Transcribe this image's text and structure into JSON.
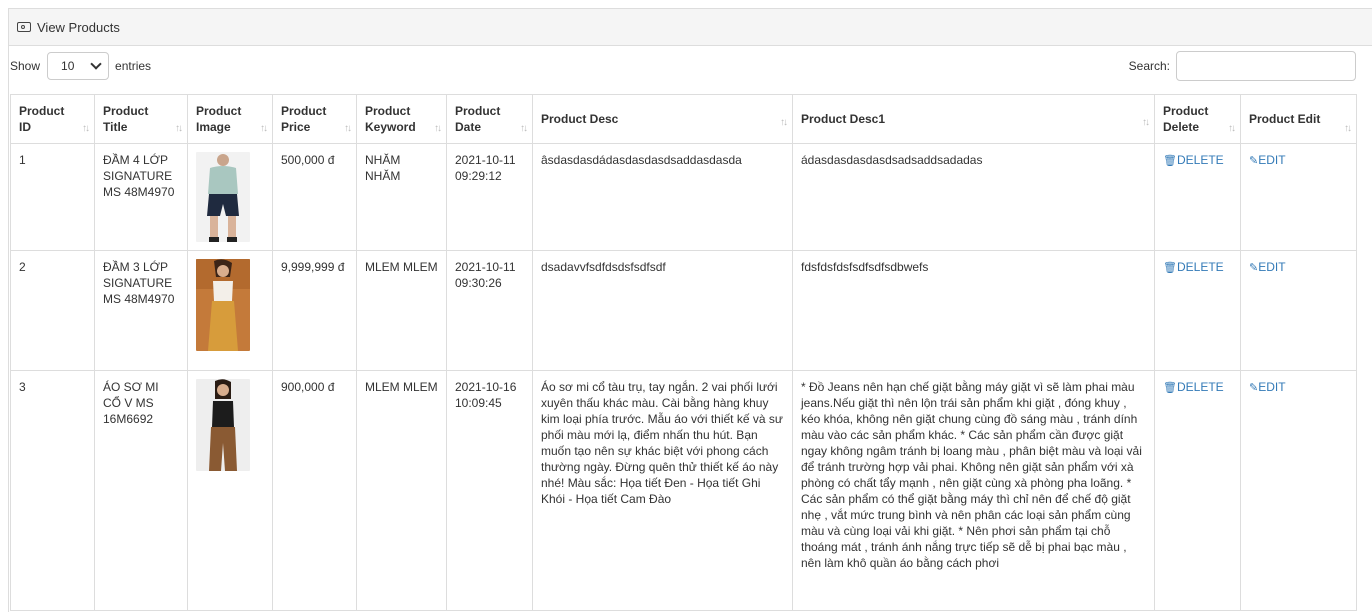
{
  "panel": {
    "title": "View Products",
    "icon": "image-icon"
  },
  "length": {
    "prefix": "Show",
    "value": "10",
    "suffix": "entries"
  },
  "search": {
    "label": "Search:",
    "value": ""
  },
  "columns": [
    "Product ID",
    "Product Title",
    "Product Image",
    "Product Price",
    "Product Keyword",
    "Product Date",
    "Product Desc",
    "Product Desc1",
    "Product Delete",
    "Product Edit"
  ],
  "rows": [
    {
      "id": "1",
      "title": "ĐẦM 4 LỚP SIGNATURE MS 48M4970",
      "price": "500,000 đ",
      "keyword": "NHĂM NHĂM",
      "date": "2021-10-11 09:29:12",
      "desc": "âsdasdasdádasdasdasdsaddasdasda",
      "desc1": "ádasdasdasdasdsadsaddsadadas",
      "delete": "DELETE",
      "edit": "EDIT"
    },
    {
      "id": "2",
      "title": "ĐẦM 3 LỚP SIGNATURE MS 48M4970",
      "price": "9,999,999 đ",
      "keyword": "MLEM MLEM",
      "date": "2021-10-11 09:30:26",
      "desc": "dsadavvfsdfdsdsfsdfsdf",
      "desc1": "fdsfdsfdsfsdfsdfsdbwefs",
      "delete": "DELETE",
      "edit": "EDIT"
    },
    {
      "id": "3",
      "title": "ÁO SƠ MI CỔ V MS 16M6692",
      "price": "900,000 đ",
      "keyword": "MLEM MLEM",
      "date": "2021-10-16 10:09:45",
      "desc": "Áo sơ mi cổ tàu trụ, tay ngắn. 2 vai phối lưới xuyên thấu khác màu. Cài bằng hàng khuy kim loại phía trước. Mẫu áo với thiết kế và sư phối màu mới lạ, điểm nhấn thu hút. Bạn muốn tạo nên sự khác biệt với phong cách thường ngày. Đừng quên thử thiết kế áo này nhé! Màu sắc: Họa tiết Đen - Họa tiết Ghi Khói - Họa tiết Cam Đào",
      "desc1": "* Đồ Jeans nên hạn chế giặt bằng máy giặt vì sẽ làm phai màu jeans.Nếu giặt thì nên lộn trái sản phẩm khi giặt , đóng khuy , kéo khóa, không nên giặt chung cùng đồ sáng màu , tránh dính màu vào các sản phẩm khác. * Các sản phẩm cần được giặt ngay không ngâm tránh bị loang màu , phân biệt màu và loại vải để tránh trường hợp vải phai. Không nên giặt sản phẩm với xà phòng có chất tẩy mạnh , nên giặt cùng xà phòng pha loãng. * Các sản phẩm có thể giặt bằng máy thì chỉ nên để chế độ giặt nhẹ , vắt mức trung bình và nên phân các loại sản phẩm cùng màu và cùng loại vải khi giặt. * Nên phơi sản phẩm tại chỗ thoáng mát , tránh ánh nắng trực tiếp sẽ dễ bị phai bạc màu , nên làm khô quần áo bằng cách phơi",
      "delete": "DELETE",
      "edit": "EDIT"
    }
  ],
  "icons": {
    "delete": "trash-icon",
    "edit": "pencil-icon",
    "sort": "sort-icon"
  },
  "colors": {
    "link": "#337ab7",
    "header_bg": "#f5f5f5",
    "border": "#dddddd"
  }
}
